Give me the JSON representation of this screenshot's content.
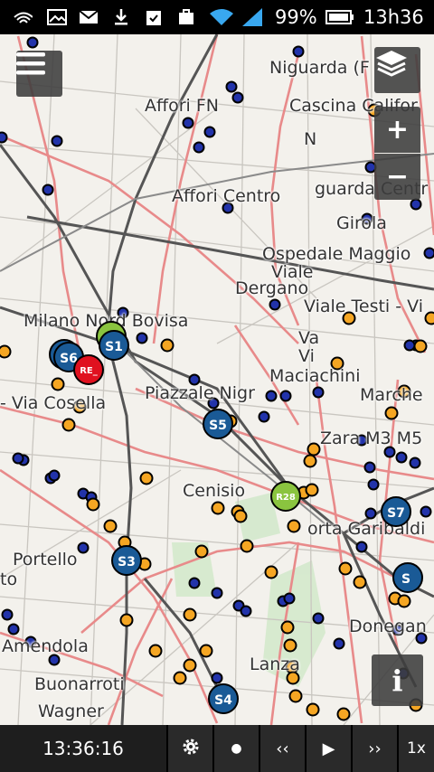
{
  "status_bar": {
    "battery": "99%",
    "time": "13h36"
  },
  "map": {
    "place_labels": [
      "Niguarda (F",
      "Affori FN",
      "Cascina Califor",
      "N",
      "Affori Centro",
      "guarda Centr",
      "Girola",
      "Ospedale Maggio",
      "Viale",
      "Dergano",
      "Viale Testi - Vi",
      "Milano Nord Bovisa",
      "Va",
      "Vi",
      "Maciachini",
      "- Via Cosella",
      "Piazzale Nigr",
      "Marche",
      "Zara M3 M5",
      "Cenisio",
      "orta Garibaldi",
      "Portello",
      "to",
      "Amendola",
      "Lanza",
      "Donegan",
      "Buonarroti",
      "Wagner"
    ],
    "train_badges": [
      "S1",
      "S6",
      "RE_",
      "S5",
      "R28",
      "S7",
      "S3",
      "S4",
      "S"
    ],
    "colors": {
      "suburban": "#1a5a96",
      "regional": "#e0111f",
      "r28": "#8ac43f",
      "bus_stop": "#f5a623",
      "tram_stop": "#2233aa",
      "tram_line": "#e88a8a"
    }
  },
  "controls": {
    "zoom_in": "+",
    "zoom_out": "−",
    "info": "i"
  },
  "bottom_bar": {
    "clock": "13:36:16",
    "dot": "●",
    "rewind": "‹‹",
    "play": "▶",
    "forward": "››",
    "speed": "1x"
  }
}
